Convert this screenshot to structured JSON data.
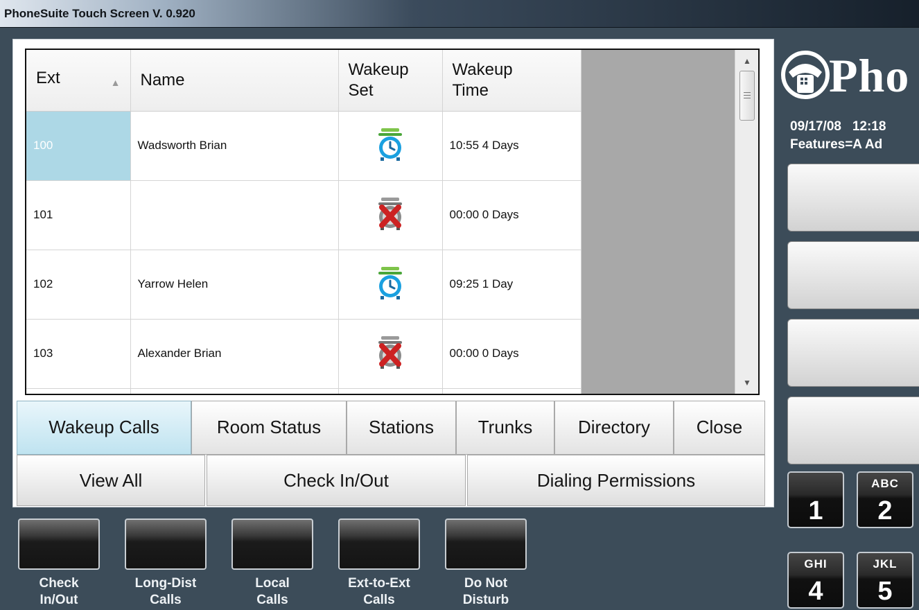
{
  "window": {
    "title": "PhoneSuite Touch Screen V. 0.920"
  },
  "table": {
    "headers": {
      "ext": "Ext",
      "name": "Name",
      "wakeup_set": [
        "Wakeup",
        "Set"
      ],
      "wakeup_time": [
        "Wakeup",
        "Time"
      ]
    },
    "rows": [
      {
        "ext": "100",
        "name": "Wadsworth  Brian",
        "wakeup_set": "alarm-clock-set-icon",
        "time": "10:55 4 Days"
      },
      {
        "ext": "101",
        "name": "",
        "wakeup_set": "alarm-clock-off-icon",
        "time": "00:00 0 Days"
      },
      {
        "ext": "102",
        "name": "Yarrow  Helen",
        "wakeup_set": "alarm-clock-set-icon",
        "time": "09:25 1 Day"
      },
      {
        "ext": "103",
        "name": "Alexander  Brian",
        "wakeup_set": "alarm-clock-off-icon",
        "time": "00:00 0 Days"
      }
    ]
  },
  "tabs": [
    "Wakeup Calls",
    "Room Status",
    "Stations",
    "Trunks",
    "Directory",
    "Close"
  ],
  "subtabs": [
    "View All",
    "Check In/Out",
    "Dialing Permissions"
  ],
  "features": [
    {
      "line1": "Check",
      "line2": "In/Out"
    },
    {
      "line1": "Long-Dist",
      "line2": "Calls"
    },
    {
      "line1": "Local",
      "line2": "Calls"
    },
    {
      "line1": "Ext-to-Ext",
      "line2": "Calls"
    },
    {
      "line1": "Do Not",
      "line2": "Disturb"
    }
  ],
  "side": {
    "logo_text": "Pho",
    "date": "09/17/08",
    "time": "12:18",
    "features": "Features=A Ad"
  },
  "keypad": [
    {
      "digit": "1",
      "letters": ""
    },
    {
      "digit": "2",
      "letters": "ABC"
    },
    {
      "digit": "4",
      "letters": "GHI"
    },
    {
      "digit": "5",
      "letters": "JKL"
    }
  ],
  "colors": {
    "background": "#3c4c59",
    "selected_row": "#add8e6",
    "active_tab": "#bfe3f0",
    "alarm_set": "#1aa0e0",
    "alarm_off": "#cc2222"
  }
}
